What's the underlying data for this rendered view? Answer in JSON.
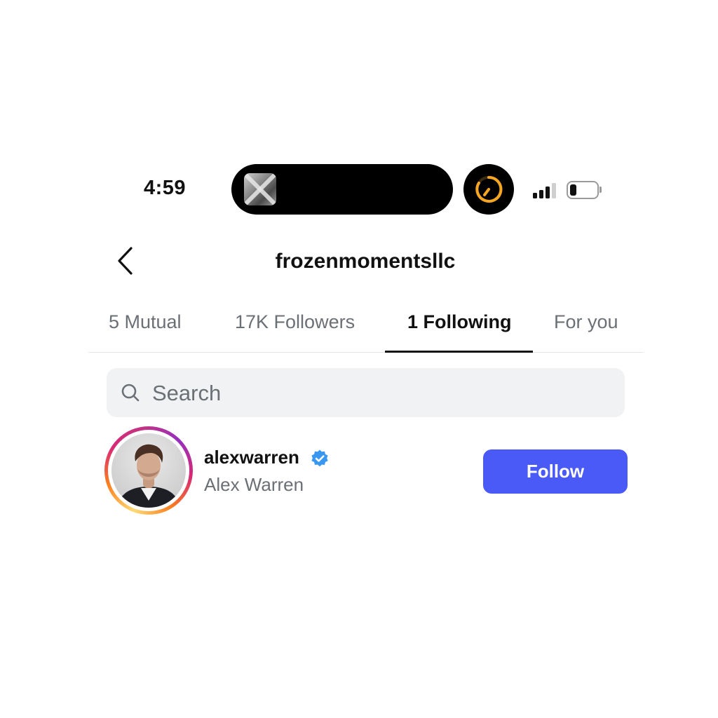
{
  "status_bar": {
    "time": "4:59"
  },
  "header": {
    "title": "frozenmomentsllc",
    "back_icon": "chevron-left-icon"
  },
  "tabs": [
    {
      "label": "5 Mutual",
      "active": false
    },
    {
      "label": "17K Followers",
      "active": false
    },
    {
      "label": "1 Following",
      "active": true
    },
    {
      "label": "For you",
      "active": false
    }
  ],
  "search": {
    "placeholder": "Search",
    "value": ""
  },
  "users": [
    {
      "username": "alexwarren",
      "full_name": "Alex Warren",
      "verified": true,
      "follow_label": "Follow"
    }
  ],
  "colors": {
    "accent": "#4a5af7",
    "verified": "#3897f0",
    "timer": "#f5a623"
  }
}
